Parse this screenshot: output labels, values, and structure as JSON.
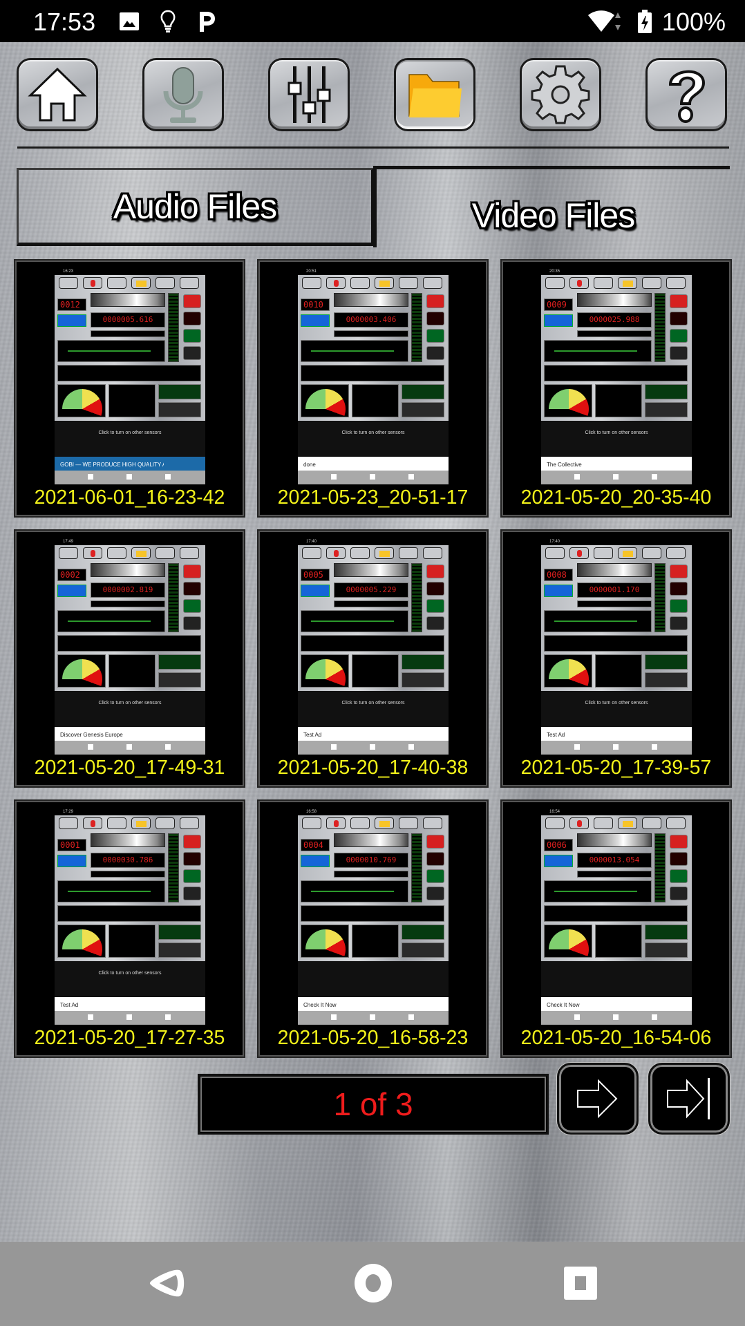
{
  "status_bar": {
    "time": "17:53",
    "left_icons": [
      "image-icon",
      "lightbulb-icon",
      "parking-p-icon"
    ],
    "right_icons": [
      "wifi-icon",
      "battery-charging-icon"
    ],
    "battery": "100%"
  },
  "toolbar": {
    "buttons": [
      {
        "name": "home",
        "icon": "home-icon"
      },
      {
        "name": "microphone",
        "icon": "microphone-icon"
      },
      {
        "name": "equalizer",
        "icon": "sliders-icon"
      },
      {
        "name": "files",
        "icon": "folder-icon",
        "active": true
      },
      {
        "name": "settings",
        "icon": "gear-icon"
      },
      {
        "name": "help",
        "icon": "question-icon"
      }
    ]
  },
  "tabs": {
    "audio": {
      "label": "Audio Files",
      "selected": false
    },
    "video": {
      "label": "Video Files",
      "selected": true
    }
  },
  "videos": [
    {
      "label": "2021-06-01_16-23-42",
      "thumb": {
        "time": "16:23",
        "counter": "0012",
        "reading": "0000005.616",
        "ad": "GOBI — WE PRODUCE HIGH QUALITY AND ECO-FRIENDLY CASHMERE",
        "sensor_text": "Click to turn on other sensors"
      }
    },
    {
      "label": "2021-05-23_20-51-17",
      "thumb": {
        "time": "20:51",
        "counter": "0010",
        "reading": "0000003.406",
        "ad": "done",
        "sensor_text": "Click to turn on other sensors"
      }
    },
    {
      "label": "2021-05-20_20-35-40",
      "thumb": {
        "time": "20:35",
        "counter": "0009",
        "reading": "0000025.988",
        "ad": "The Collective",
        "sensor_text": "Click to turn on other sensors"
      }
    },
    {
      "label": "2021-05-20_17-49-31",
      "thumb": {
        "time": "17:49",
        "counter": "0002",
        "reading": "0000002.819",
        "ad": "Discover Genesis Europe",
        "sensor_text": "Click to turn on other sensors"
      }
    },
    {
      "label": "2021-05-20_17-40-38",
      "thumb": {
        "time": "17:40",
        "counter": "0005",
        "reading": "0000005.229",
        "ad": "Test Ad",
        "sensor_text": "Click to turn on other sensors"
      }
    },
    {
      "label": "2021-05-20_17-39-57",
      "thumb": {
        "time": "17:40",
        "counter": "0008",
        "reading": "0000001.170",
        "ad": "Test Ad",
        "sensor_text": "Click to turn on other sensors"
      }
    },
    {
      "label": "2021-05-20_17-27-35",
      "thumb": {
        "time": "17:29",
        "counter": "0001",
        "reading": "0000030.786",
        "ad": "Test Ad",
        "sensor_text": "Click to turn on other sensors"
      }
    },
    {
      "label": "2021-05-20_16-58-23",
      "thumb": {
        "time": "16:58",
        "counter": "0004",
        "reading": "0000010.769",
        "ad": "Check It Now",
        "sensor_text": ""
      }
    },
    {
      "label": "2021-05-20_16-54-06",
      "thumb": {
        "time": "16:54",
        "counter": "0006",
        "reading": "0000013.054",
        "ad": "Check It Now",
        "sensor_text": ""
      }
    }
  ],
  "pagination": {
    "text": "1 of 3",
    "current": 1,
    "total": 3,
    "next_icon": "arrow-right-icon",
    "last_icon": "arrow-right-bar-icon"
  },
  "colors": {
    "label_yellow": "#f2f21a",
    "page_red": "#ee1c1c",
    "folder_orange": "#f7b718"
  },
  "nav_bar": {
    "buttons": [
      "back-icon",
      "home-circle-icon",
      "recents-square-icon"
    ]
  }
}
